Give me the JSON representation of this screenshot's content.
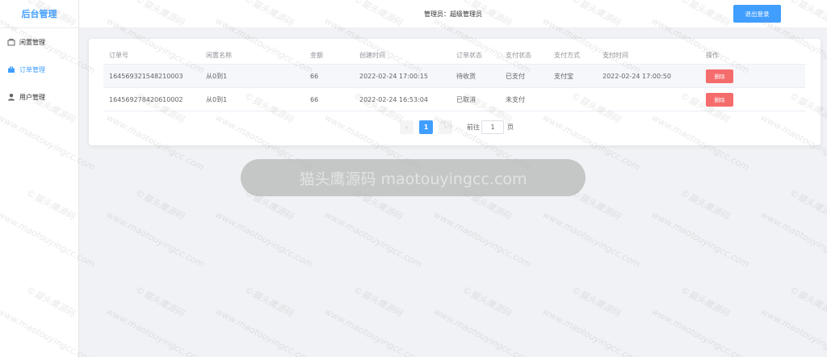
{
  "app": {
    "title": "后台管理"
  },
  "sidebar": {
    "items": [
      {
        "label": "闲置管理",
        "icon": "box-icon",
        "active": false
      },
      {
        "label": "订单管理",
        "icon": "briefcase-icon",
        "active": true
      },
      {
        "label": "用户管理",
        "icon": "user-icon",
        "active": false
      }
    ]
  },
  "header": {
    "admin_text": "管理员：超级管理员",
    "logout_label": "退出登录"
  },
  "table": {
    "columns": [
      "订单号",
      "闲置名称",
      "金额",
      "创建时间",
      "订单状态",
      "支付状态",
      "支付方式",
      "支付时间",
      "操作"
    ],
    "rows": [
      {
        "order_no": "164569321548210003",
        "item_name": "从0到1",
        "amount": "66",
        "created_at": "2022-02-24 17:00:15",
        "order_status": "待收货",
        "pay_status": "已支付",
        "pay_method": "支付宝",
        "paid_at": "2022-02-24 17:00:50",
        "action": "删除"
      },
      {
        "order_no": "164569278420610002",
        "item_name": "从0到1",
        "amount": "66",
        "created_at": "2022-02-24 16:53:04",
        "order_status": "已取消",
        "pay_status": "未支付",
        "pay_method": "",
        "paid_at": "",
        "action": "删除"
      }
    ]
  },
  "pagination": {
    "prev_icon": "chevron-left-icon",
    "current_page": "1",
    "next_icon": "chevron-right-icon",
    "goto_label": "前往",
    "goto_value": "1",
    "page_suffix": "页"
  },
  "watermark": {
    "banner": "猫头鹰源码 maotouyingcc.com",
    "line1": "©猫头鹰源码",
    "line2": "www.maotouyingcc.com"
  },
  "colors": {
    "accent": "#409eff",
    "danger": "#f56c6c",
    "background": "#f0f2f5"
  }
}
